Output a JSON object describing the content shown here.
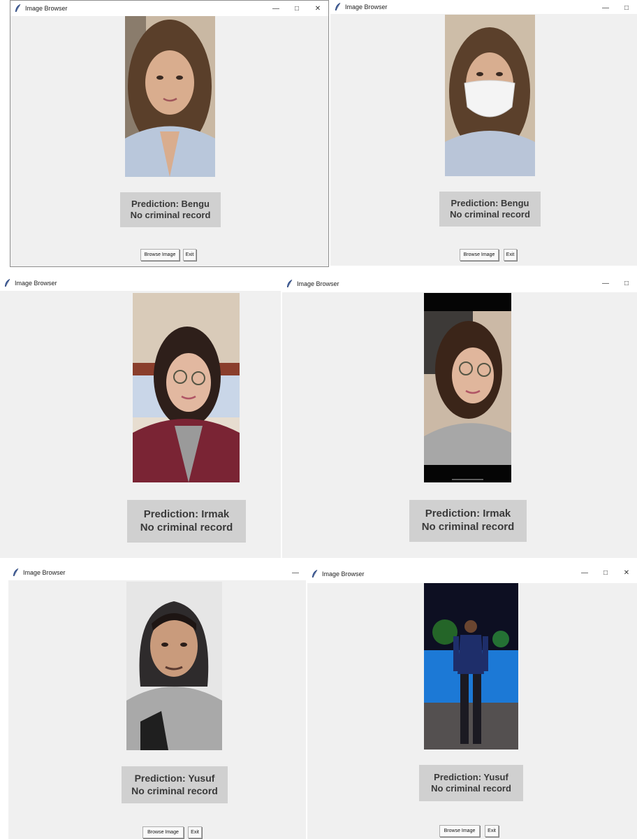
{
  "windows": [
    {
      "title": "Image Browser",
      "prediction_line": "Prediction: Bengu",
      "record_line": "No criminal record",
      "browse_label": "Browse Image",
      "exit_label": "Exit",
      "photo": "woman-portrait-smiling"
    },
    {
      "title": "Image Browser",
      "prediction_line": "Prediction: Bengu",
      "record_line": "No criminal record",
      "browse_label": "Browse Image",
      "exit_label": "Exit",
      "photo": "woman-portrait-face-mask"
    },
    {
      "title": "Image Browser",
      "prediction_line": "Prediction: Irmak",
      "record_line": "No criminal record",
      "photo": "woman-portrait-glasses-maroon-jacket"
    },
    {
      "title": "Image Browser",
      "prediction_line": "Prediction: Irmak",
      "record_line": "No criminal record",
      "photo": "woman-portrait-glasses-reclining"
    },
    {
      "title": "Image Browser",
      "prediction_line": "Prediction: Yusuf",
      "record_line": "No criminal record",
      "browse_label": "Browse Image",
      "exit_label": "Exit",
      "photo": "man-portrait-hoodie"
    },
    {
      "title": "Image Browser",
      "prediction_line": "Prediction: Yusuf",
      "record_line": "No criminal record",
      "browse_label": "Browse Image",
      "exit_label": "Exit",
      "photo": "man-standing-by-pool-night"
    }
  ],
  "icons": {
    "app": "feather-icon",
    "minimize": "minimize-icon",
    "maximize": "maximize-icon",
    "close": "close-icon"
  },
  "colors": {
    "window_bg": "#f0f0f0",
    "label_bg": "#d0d0d0",
    "label_text": "#3a3a3a",
    "titlebar_bg": "#ffffff"
  }
}
